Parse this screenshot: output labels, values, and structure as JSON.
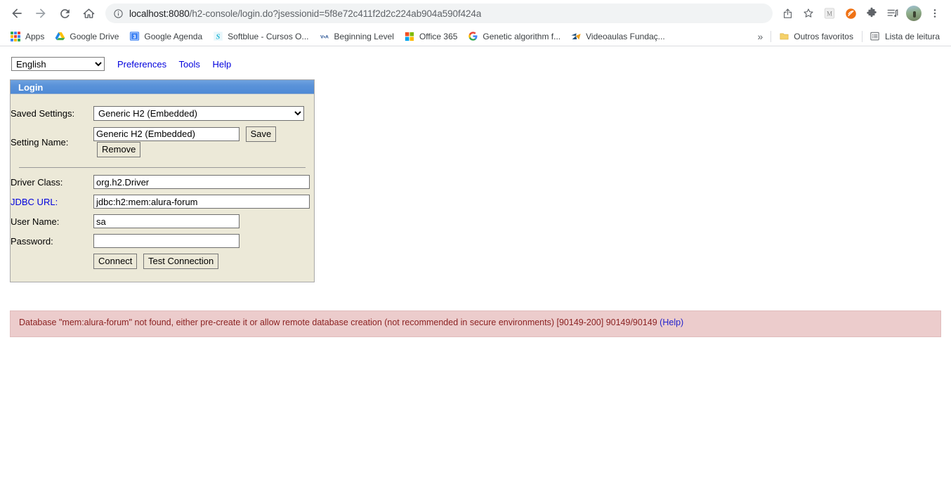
{
  "browser": {
    "nav": {
      "back_icon": "arrow-left-icon",
      "forward_icon": "arrow-right-icon",
      "reload_icon": "reload-icon",
      "home_icon": "home-icon"
    },
    "omnibox": {
      "info_icon": "site-info-icon",
      "host": "localhost:8080",
      "path": "/h2-console/login.do?jsessionid=5f8e72c411f2d2c224ab904a590f424a",
      "full_url": "localhost:8080/h2-console/login.do?jsessionid=5f8e72c411f2d2c224ab904a590f424a"
    },
    "toolbar_icons": [
      {
        "name": "share-icon"
      },
      {
        "name": "bookmark-star-icon"
      },
      {
        "name": "extension-m-icon",
        "label": "M"
      },
      {
        "name": "extension-orange-icon"
      },
      {
        "name": "extensions-puzzle-icon"
      },
      {
        "name": "media-playlist-icon"
      },
      {
        "name": "profile-avatar-icon"
      },
      {
        "name": "chrome-menu-icon"
      }
    ],
    "bookmarks": [
      {
        "label": "Apps",
        "icon": "apps-grid-icon"
      },
      {
        "label": "Google Drive",
        "icon": "google-drive-icon"
      },
      {
        "label": "Google Agenda",
        "icon": "google-calendar-icon"
      },
      {
        "label": "Softblue - Cursos O...",
        "icon": "softblue-icon"
      },
      {
        "label": "Beginning Level",
        "icon": "voa-icon"
      },
      {
        "label": "Office 365",
        "icon": "office365-icon"
      },
      {
        "label": "Genetic algorithm f...",
        "icon": "google-g-icon"
      },
      {
        "label": "Videoaulas Fundaç...",
        "icon": "videoaulas-icon"
      }
    ],
    "bookmarks_overflow": "»",
    "bookmarks_right": [
      {
        "label": "Outros favoritos",
        "icon": "folder-icon"
      },
      {
        "label": "Lista de leitura",
        "icon": "reading-list-icon"
      }
    ]
  },
  "h2": {
    "language": {
      "selected": "English",
      "options": [
        "English"
      ]
    },
    "top_links": [
      {
        "label": "Preferences"
      },
      {
        "label": "Tools"
      },
      {
        "label": "Help"
      }
    ],
    "panel_title": "Login",
    "fields": {
      "saved_settings_label": "Saved Settings:",
      "saved_settings_value": "Generic H2 (Embedded)",
      "saved_settings_options": [
        "Generic H2 (Embedded)"
      ],
      "setting_name_label": "Setting Name:",
      "setting_name_value": "Generic H2 (Embedded)",
      "driver_class_label": "Driver Class:",
      "driver_class_value": "org.h2.Driver",
      "jdbc_url_label": "JDBC URL:",
      "jdbc_url_value": "jdbc:h2:mem:alura-forum",
      "user_name_label": "User Name:",
      "user_name_value": "sa",
      "password_label": "Password:",
      "password_value": ""
    },
    "buttons": {
      "save": "Save",
      "remove": "Remove",
      "connect": "Connect",
      "test_connection": "Test Connection"
    },
    "error": {
      "message": "Database \"mem:alura-forum\" not found, either pre-create it or allow remote database creation (not recommended in secure environments) [90149-200] 90149/90149",
      "help_link": "(Help)"
    }
  },
  "colors": {
    "panel_header_blue": "#5b93d9",
    "panel_bg": "#ece9d8",
    "link_blue": "#0000dd",
    "error_bg": "#eccccc",
    "error_text": "#8b2222"
  }
}
